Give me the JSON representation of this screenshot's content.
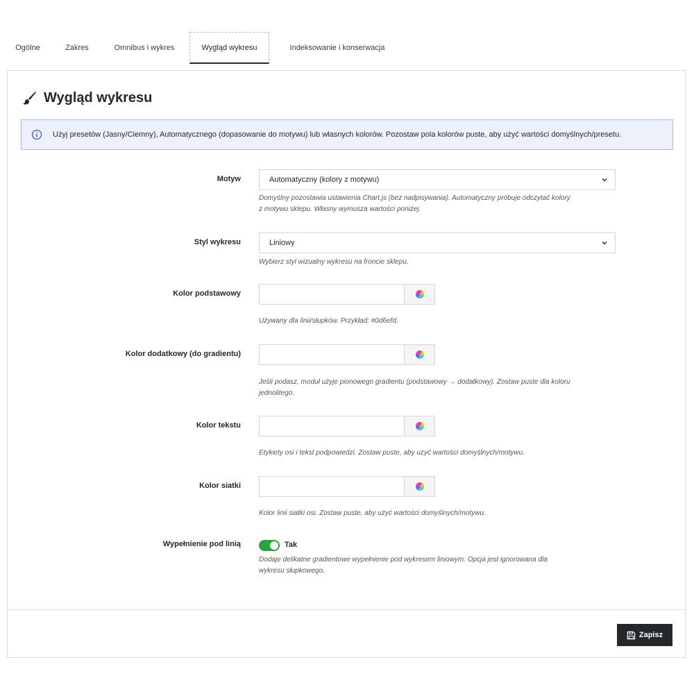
{
  "tabs": [
    {
      "label": "Ogólne"
    },
    {
      "label": "Zakres"
    },
    {
      "label": "Omnibus i wykres"
    },
    {
      "label": "Wygląd wykresu",
      "active": true
    },
    {
      "label": "Indeksowanie i konserwacja"
    }
  ],
  "panel": {
    "title": "Wygląd wykresu",
    "icon": "paintbrush-icon",
    "alert": "Użyj presetów (Jasny/Ciemny), Automatycznego (dopasowanie do motywu) lub własnych kolorów. Pozostaw pola kolorów puste, aby użyć wartości domyślnych/presetu."
  },
  "fields": {
    "theme": {
      "label": "Motyw",
      "value": "Automatyczny (kolory z motywu)",
      "help_line1": "Domyślny pozostawia ustawienia Chart.js (bez nadpisywania). Automatyczny próbuje odczytać kolory",
      "help_line2": "z motywu sklepu. Własny wymusza wartości poniżej."
    },
    "style": {
      "label": "Styl wykresu",
      "value": "Liniowy",
      "help": "Wybierz styl wizualny wykresu na froncie sklepu."
    },
    "primary": {
      "label": "Kolor podstawowy",
      "value": "",
      "help": "Używany dla linii/słupków. Przykład: #0d6efd."
    },
    "secondary": {
      "label": "Kolor dodatkowy (do gradientu)",
      "value": "",
      "help_line1": "Jeśli podasz, moduł użyje pionowego gradientu (podstawowy → dodatkowy). Zostaw puste dla koloru",
      "help_line2": "jednolitego."
    },
    "text_color": {
      "label": "Kolor tekstu",
      "value": "",
      "help": "Etykiety osi i tekst podpowiedzi. Zostaw puste, aby użyć wartości domyślnych/motywu."
    },
    "grid_color": {
      "label": "Kolor siatki",
      "value": "",
      "help": "Kolor linii siatki osi. Zostaw puste, aby użyć wartości domyślnych/motywu."
    },
    "fill": {
      "label": "Wypełnienie pod linią",
      "toggle_label": "Tak",
      "enabled": true,
      "help_line1": "Dodaje delikatne gradientowe wypełnienie pod wykresem liniowym. Opcja jest ignorowana dla",
      "help_line2": "wykresu słupkowego."
    }
  },
  "footer": {
    "save_label": "Zapisz",
    "save_icon": "floppy-disk-icon"
  },
  "colors": {
    "toggle_on": "#25a53a",
    "alert_bg": "#edf1fc",
    "alert_border": "#aab7ee",
    "save_bg": "#25282b"
  }
}
